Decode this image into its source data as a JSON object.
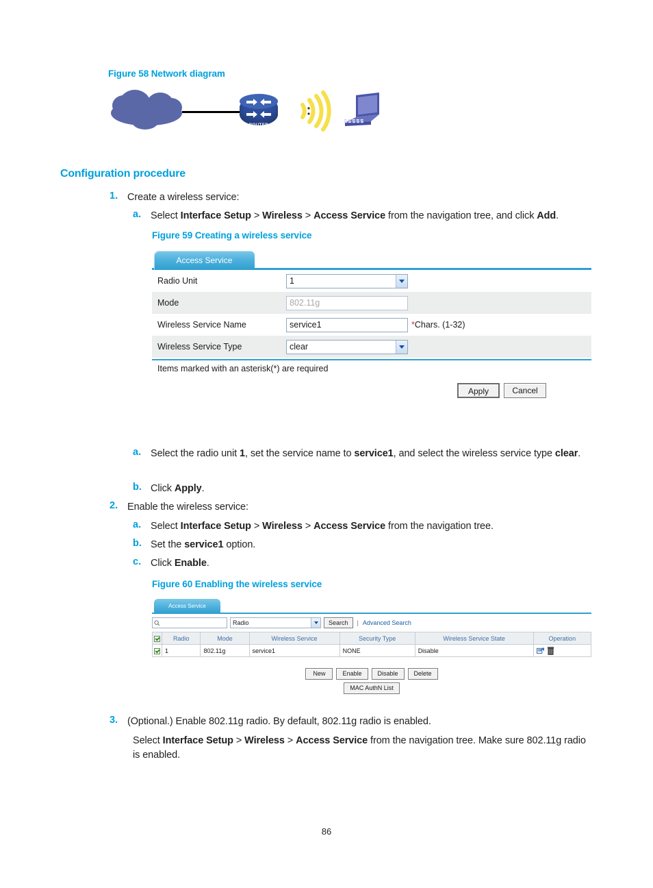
{
  "figure58": {
    "caption": "Figure 58 Network diagram",
    "nodes": {
      "cloud": "network-cloud",
      "router": "ROUTER",
      "signal": "wireless-signal",
      "client": "laptop-client"
    }
  },
  "section": {
    "heading": "Configuration procedure"
  },
  "steps": {
    "s1": {
      "marker": "1.",
      "text": "Create a wireless service:"
    },
    "s1a": {
      "marker": "a.",
      "parts": [
        {
          "t": "Select ",
          "b": false
        },
        {
          "t": "Interface Setup",
          "b": true
        },
        {
          "t": " > ",
          "b": false
        },
        {
          "t": "Wireless",
          "b": true
        },
        {
          "t": " > ",
          "b": false
        },
        {
          "t": "Access Service",
          "b": true
        },
        {
          "t": " from the navigation tree, and click ",
          "b": false
        },
        {
          "t": "Add",
          "b": true
        },
        {
          "t": ".",
          "b": false
        }
      ]
    },
    "s2a": {
      "marker": "a.",
      "parts": [
        {
          "t": "Select the radio unit ",
          "b": false
        },
        {
          "t": "1",
          "b": true
        },
        {
          "t": ", set the service name to ",
          "b": false
        },
        {
          "t": "service1",
          "b": true
        },
        {
          "t": ", and select the wireless service type ",
          "b": false
        },
        {
          "t": "clear",
          "b": true
        },
        {
          "t": ".",
          "b": false
        }
      ]
    },
    "s2b": {
      "marker": "b.",
      "parts": [
        {
          "t": "Click ",
          "b": false
        },
        {
          "t": "Apply",
          "b": true
        },
        {
          "t": ".",
          "b": false
        }
      ]
    },
    "s3": {
      "marker": "2.",
      "text": "Enable the wireless service:"
    },
    "s3a": {
      "marker": "a.",
      "parts": [
        {
          "t": "Select ",
          "b": false
        },
        {
          "t": "Interface Setup",
          "b": true
        },
        {
          "t": " > ",
          "b": false
        },
        {
          "t": "Wireless",
          "b": true
        },
        {
          "t": " > ",
          "b": false
        },
        {
          "t": "Access Service",
          "b": true
        },
        {
          "t": " from the navigation tree.",
          "b": false
        }
      ]
    },
    "s3b": {
      "marker": "b.",
      "parts": [
        {
          "t": "Set the ",
          "b": false
        },
        {
          "t": "service1",
          "b": true
        },
        {
          "t": " option.",
          "b": false
        }
      ]
    },
    "s3c": {
      "marker": "c.",
      "parts": [
        {
          "t": "Click ",
          "b": false
        },
        {
          "t": "Enable",
          "b": true
        },
        {
          "t": ".",
          "b": false
        }
      ]
    },
    "s4": {
      "marker": "3.",
      "text": "(Optional.) Enable 802.11g radio. By default, 802.11g radio is enabled."
    },
    "s4p": {
      "parts": [
        {
          "t": "Select ",
          "b": false
        },
        {
          "t": "Interface Setup",
          "b": true
        },
        {
          "t": " > ",
          "b": false
        },
        {
          "t": "Wireless",
          "b": true
        },
        {
          "t": " > ",
          "b": false
        },
        {
          "t": "Access Service",
          "b": true
        },
        {
          "t": " from the navigation tree. Make sure 802.11g radio is enabled.",
          "b": false
        }
      ]
    }
  },
  "figure59": {
    "caption": "Figure 59 Creating a wireless service",
    "tab": "Access Service",
    "rows": [
      {
        "label": "Radio Unit",
        "control": "select",
        "value": "1",
        "required": false,
        "hint": ""
      },
      {
        "label": "Mode",
        "control": "input",
        "value": "802.11g",
        "required": false,
        "hint": "",
        "disabled": true
      },
      {
        "label": "Wireless Service Name",
        "control": "input",
        "value": "service1",
        "required": true,
        "hint": "Chars. (1-32)"
      },
      {
        "label": "Wireless Service Type",
        "control": "select",
        "value": "clear",
        "required": false,
        "hint": ""
      }
    ],
    "note": "Items marked with an asterisk(*) are required",
    "buttons": {
      "apply": "Apply",
      "cancel": "Cancel"
    }
  },
  "figure60": {
    "caption": "Figure 60 Enabling the wireless service",
    "tab": "Access Service",
    "search": {
      "placeholder": "",
      "value": "",
      "field_selected": "Radio",
      "search_button": "Search",
      "advanced_link": "Advanced Search",
      "icon": "magnifier-icon"
    },
    "table": {
      "headers": [
        "Radio",
        "Mode",
        "Wireless Service",
        "Security Type",
        "Wireless Service State",
        "Operation"
      ],
      "rows": [
        {
          "checked": true,
          "radio": "1",
          "mode": "802.11g",
          "wireless_service": "service1",
          "security_type": "NONE",
          "state": "Disable",
          "operation": [
            "edit-icon",
            "delete-icon"
          ]
        }
      ]
    },
    "buttons": [
      "New",
      "Enable",
      "Disable",
      "Delete"
    ],
    "buttons_row2": [
      "MAC AuthN List"
    ]
  },
  "footer": {
    "page_number": "86"
  },
  "colors": {
    "heading_blue": "#00a0dc",
    "tab_blue": "#2f9fd0",
    "cloud_blue": "#5a68a8",
    "router_blue": "#2e4f9e",
    "signal_yellow": "#f5e04a",
    "laptop_blue": "#5a62b8",
    "required_red": "#e8262c",
    "link_blue": "#1b5fa8"
  }
}
